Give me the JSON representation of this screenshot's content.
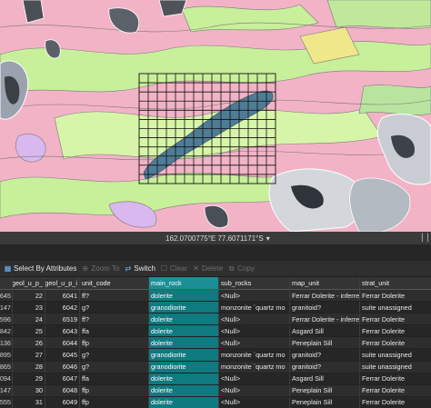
{
  "coordinates": "162.0700775°E 77.6071171°S",
  "toolbar": {
    "select_by_attributes": "Select By Attributes",
    "zoom_to": "Zoom To",
    "switch": "Switch",
    "clear": "Clear",
    "delete": "Delete",
    "copy": "Copy"
  },
  "table": {
    "columns": [
      "",
      "geol_u_p_",
      "geol_u_p_i",
      "unit_code",
      "main_rock",
      "sub_rocks",
      "map_unit",
      "strat_unit"
    ],
    "rows": [
      [
        "645",
        "22",
        "6041",
        "ff?",
        "dolerite",
        "<Null>",
        "Ferrar Dolerite - inferred",
        "Ferrar Dolerite"
      ],
      [
        "147",
        "23",
        "6042",
        "g?",
        "granodiorite",
        "monzonite `quartz mo",
        "granitoid?",
        "suite unassigned"
      ],
      [
        "596",
        "24",
        "6519",
        "ff?",
        "dolerite",
        "<Null>",
        "Ferrar Dolerite - inferred",
        "Ferrar Dolerite"
      ],
      [
        "842",
        "25",
        "6043",
        "ffa",
        "dolerite",
        "<Null>",
        "Asgard Sill",
        "Ferrar Dolerite"
      ],
      [
        "136",
        "26",
        "6044",
        "ffp",
        "dolerite",
        "<Null>",
        "Peneplain Sill",
        "Ferrar Dolerite"
      ],
      [
        "895",
        "27",
        "6045",
        "g?",
        "granodiorite",
        "monzonite `quartz mo",
        "granitoid?",
        "suite unassigned"
      ],
      [
        "865",
        "28",
        "6046",
        "g?",
        "granodiorite",
        "monzonite `quartz mo",
        "granitoid?",
        "suite unassigned"
      ],
      [
        "094",
        "29",
        "6047",
        "ffa",
        "dolerite",
        "<Null>",
        "Asgard Sill",
        "Ferrar Dolerite"
      ],
      [
        "147",
        "30",
        "6048",
        "ffp",
        "dolerite",
        "<Null>",
        "Peneplain Sill",
        "Ferrar Dolerite"
      ],
      [
        "555",
        "31",
        "6049",
        "ffp",
        "dolerite",
        "<Null>",
        "Peneplain Sill",
        "Ferrar Dolerite"
      ]
    ]
  }
}
